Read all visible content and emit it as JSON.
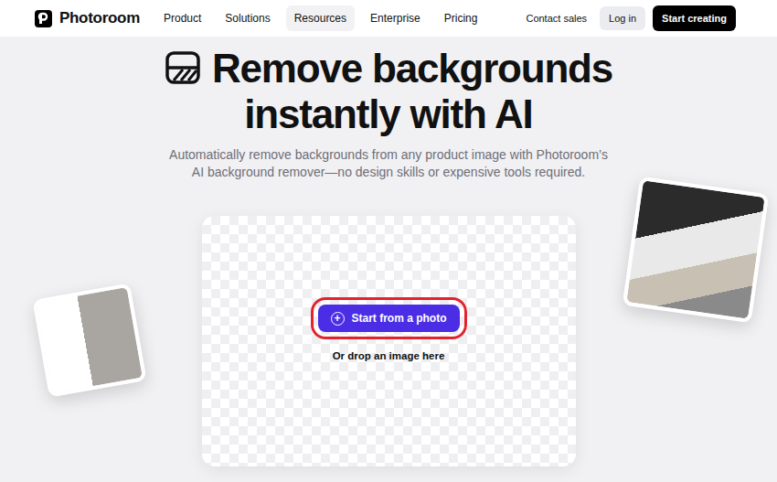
{
  "logo": {
    "name": "Photoroom"
  },
  "nav": {
    "items": [
      {
        "label": "Product",
        "selected": false
      },
      {
        "label": "Solutions",
        "selected": false
      },
      {
        "label": "Resources",
        "selected": true
      },
      {
        "label": "Enterprise",
        "selected": false
      },
      {
        "label": "Pricing",
        "selected": false
      }
    ]
  },
  "actions": {
    "contact": "Contact sales",
    "login": "Log in",
    "start": "Start creating"
  },
  "hero": {
    "title_lines": [
      "Remove backgrounds",
      "instantly with AI"
    ],
    "subtitle_lines": [
      "Automatically remove backgrounds from any product image with Photoroom’s",
      "AI background remover—no design skills or expensive tools required."
    ]
  },
  "upload": {
    "button": {
      "icon": "+",
      "label": "Start from a photo",
      "highlighted": true
    },
    "hint": "Or drop an image here"
  }
}
